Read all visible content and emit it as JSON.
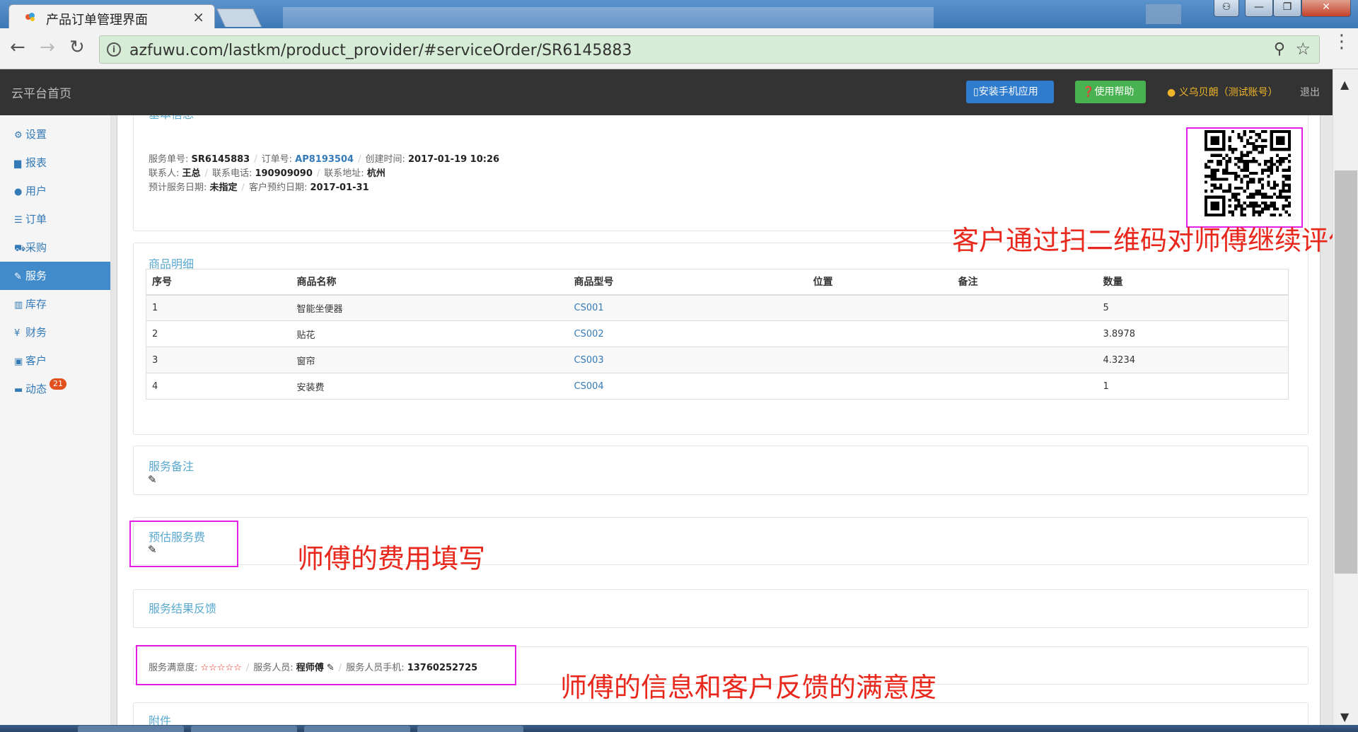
{
  "browser": {
    "tab_title": "产品订单管理界面",
    "tab_close": "×",
    "url": "azfuwu.com/lastkm/product_provider/#serviceOrder/SR6145883",
    "window_buttons": {
      "user": "⚇",
      "min": "—",
      "max": "❐",
      "close": "✕"
    }
  },
  "header": {
    "brand": "云平台首页",
    "install_app": "安装手机应用",
    "help": "使用帮助",
    "user": "义乌贝朗（测试账号）",
    "logout": "退出"
  },
  "sidebar": {
    "items": [
      {
        "icon": "gear-icon",
        "glyph": "⚙",
        "label": "设置"
      },
      {
        "icon": "bar-chart-icon",
        "glyph": "▆",
        "label": "报表"
      },
      {
        "icon": "user-icon",
        "glyph": "●",
        "label": "用户"
      },
      {
        "icon": "list-icon",
        "glyph": "☰",
        "label": "订单"
      },
      {
        "icon": "cart-icon",
        "glyph": "⛟",
        "label": "采购"
      },
      {
        "icon": "wrench-icon",
        "glyph": "✎",
        "label": "服务"
      },
      {
        "icon": "barcode-icon",
        "glyph": "▥",
        "label": "库存"
      },
      {
        "icon": "yen-icon",
        "glyph": "¥",
        "label": "财务"
      },
      {
        "icon": "briefcase-icon",
        "glyph": "▣",
        "label": "客户"
      },
      {
        "icon": "comment-icon",
        "glyph": "▬",
        "label": "动态"
      }
    ],
    "active_index": 5,
    "news_badge": "21"
  },
  "basic_info": {
    "title": "基本信息",
    "service_no_label": "服务单号:",
    "service_no": "SR6145883",
    "order_no_label": "订单号:",
    "order_no": "AP8193504",
    "created_label": "创建时间:",
    "created": "2017-01-19 10:26",
    "contact_label": "联系人:",
    "contact": "王总",
    "phone_label": "联系电话:",
    "phone": "190909090",
    "address_label": "联系地址:",
    "address": "杭州",
    "planned_date_label": "预计服务日期:",
    "planned_date": "未指定",
    "appt_date_label": "客户预约日期:",
    "appt_date": "2017-01-31"
  },
  "products": {
    "title": "商品明细",
    "headers": [
      "序号",
      "商品名称",
      "商品型号",
      "位置",
      "备注",
      "数量"
    ],
    "rows": [
      {
        "no": "1",
        "name": "智能坐便器",
        "model": "CS001",
        "location": "",
        "note": "",
        "qty": "5"
      },
      {
        "no": "2",
        "name": "贴花",
        "model": "CS002",
        "location": "",
        "note": "",
        "qty": "3.8978"
      },
      {
        "no": "3",
        "name": "窗帘",
        "model": "CS003",
        "location": "",
        "note": "",
        "qty": "4.3234"
      },
      {
        "no": "4",
        "name": "安装费",
        "model": "CS004",
        "location": "",
        "note": "",
        "qty": "1"
      }
    ]
  },
  "service_note": {
    "title": "服务备注"
  },
  "estimated_fee": {
    "title": "预估服务费"
  },
  "feedback": {
    "title": "服务结果反馈"
  },
  "feedback_info": {
    "satisfaction_label": "服务满意度:",
    "stars": "☆☆☆☆☆",
    "staff_label": "服务人员:",
    "staff": "程师傅",
    "staff_phone_label": "服务人员手机:",
    "staff_phone": "13760252725"
  },
  "attachments": {
    "title": "附件"
  },
  "annotations": {
    "qr_note": "客户通过扫二维码对师傅继续评价",
    "fee_note": "师傅的费用填写",
    "feedback_note": "师傅的信息和客户反馈的满意度"
  },
  "colors": {
    "accent": "#337ab7",
    "annotation_box": "#e21fe3",
    "annotation_text": "#e8281c",
    "star": "#e8281c"
  }
}
